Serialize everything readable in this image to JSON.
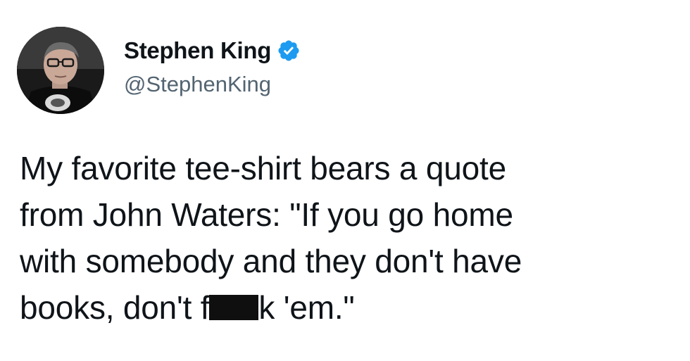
{
  "author": {
    "display_name": "Stephen King",
    "handle": "@StephenKing",
    "verified": true,
    "avatar_icon": "profile-photo"
  },
  "tweet": {
    "line1": "My favorite tee-shirt bears a quote",
    "line2": "from John Waters: \"If you go home",
    "line3": "with somebody and they don't have",
    "line4_before": "books, don't f",
    "line4_after": "k 'em.\""
  },
  "colors": {
    "verified_badge": "#1d9bf0",
    "handle_text": "#536471",
    "text": "#0f1419",
    "censor_bar": "#0f0f0f"
  }
}
